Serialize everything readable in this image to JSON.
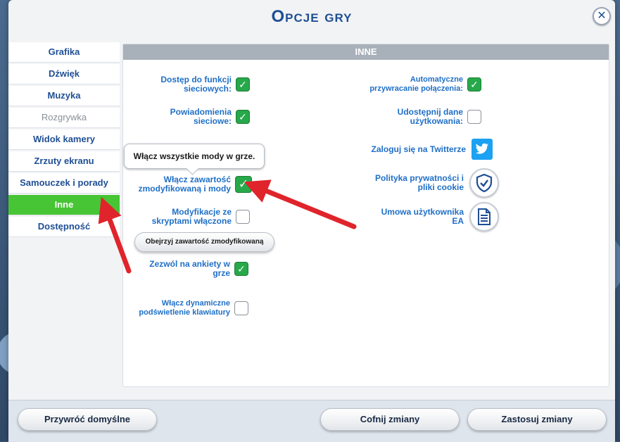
{
  "dialog": {
    "title": "Opcje gry",
    "close_glyph": "✕"
  },
  "sidebar": {
    "items": [
      {
        "label": "Grafika"
      },
      {
        "label": "Dźwięk"
      },
      {
        "label": "Muzyka"
      },
      {
        "label": "Rozgrywka"
      },
      {
        "label": "Widok kamery"
      },
      {
        "label": "Zrzuty ekranu"
      },
      {
        "label": "Samouczek i porady"
      },
      {
        "label": "Inne"
      },
      {
        "label": "Dostępność"
      }
    ],
    "active_index": 7,
    "disabled_index": 3
  },
  "panel": {
    "header": "INNE",
    "tooltip": "Włącz wszystkie mody w grze.",
    "left_options": [
      {
        "label_1": "Dostęp do funkcji",
        "label_2": "sieciowych:",
        "checked": true
      },
      {
        "label_1": "Powiadomienia",
        "label_2": "sieciowe:",
        "checked": true
      },
      {
        "label_1": "Włącz zawartość",
        "label_2": "zmodyfikowaną i mody",
        "checked": true
      },
      {
        "label_1": "Modyfikacje ze",
        "label_2": "skryptami włączone",
        "checked": false
      },
      {
        "label_1": "Zezwól na ankiety w",
        "label_2": "grze",
        "checked": true
      },
      {
        "label_1": "Włącz dynamiczne",
        "label_2": "podświetlenie klawiatury",
        "checked": false
      }
    ],
    "view_mods_button": "Obejrzyj zawartość zmodyfikowaną",
    "right_options": [
      {
        "label_1": "Automatyczne",
        "label_2": "przywracanie połączenia:",
        "checked": true
      },
      {
        "label_1": "Udostępnij dane",
        "label_2": "użytkowania:",
        "checked": false
      }
    ],
    "links": [
      {
        "label_1": "Zaloguj się na Twitterze",
        "label_2": "",
        "icon": "twitter-icon"
      },
      {
        "label_1": "Polityka prywatności i",
        "label_2": "pliki cookie",
        "icon": "shield-check-icon"
      },
      {
        "label_1": "Umowa użytkownika",
        "label_2": "EA",
        "icon": "document-icon"
      }
    ]
  },
  "footer": {
    "reset_label": "Przywróć domyślne",
    "undo_label": "Cofnij zmiany",
    "apply_label": "Zastosuj zmiany"
  },
  "colors": {
    "accent_blue": "#1f4f94",
    "label_blue": "#1f6fc6",
    "active_green": "#47c534",
    "checkbox_green": "#27a84a",
    "annotation_red": "#e0242b"
  }
}
